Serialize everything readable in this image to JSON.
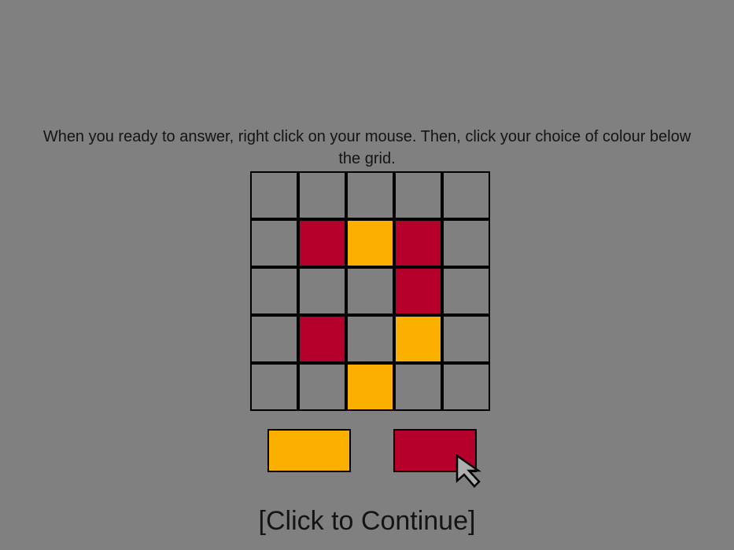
{
  "instructions": "When you ready to answer, right click on your mouse. Then, click your choice of colour below the grid.",
  "colors": {
    "background": "#808080",
    "empty": "#808080",
    "red": "#b4002a",
    "yellow": "#fbb000",
    "border": "#000000"
  },
  "grid": [
    [
      "empty",
      "empty",
      "empty",
      "empty",
      "empty"
    ],
    [
      "empty",
      "red",
      "yellow",
      "red",
      "empty"
    ],
    [
      "empty",
      "empty",
      "empty",
      "red",
      "empty"
    ],
    [
      "empty",
      "red",
      "empty",
      "yellow",
      "empty"
    ],
    [
      "empty",
      "empty",
      "yellow",
      "empty",
      "empty"
    ]
  ],
  "choices": [
    {
      "name": "yellow"
    },
    {
      "name": "red"
    }
  ],
  "cursor_icon": "pointer-arrow-icon",
  "continue_label": "[Click to Continue]"
}
